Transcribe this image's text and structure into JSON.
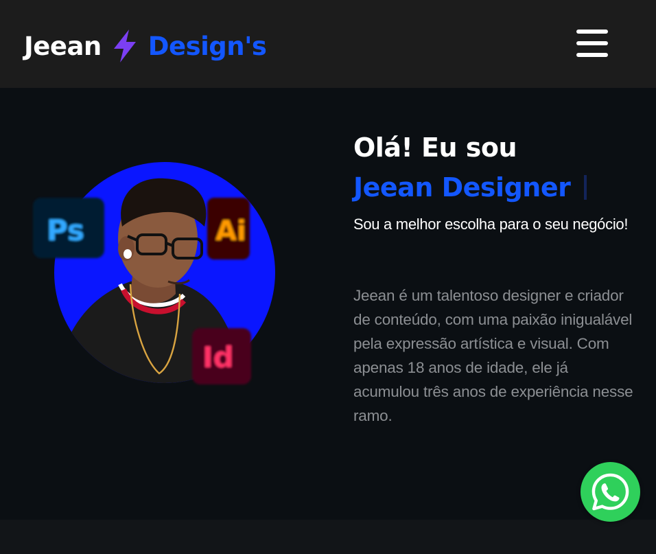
{
  "header": {
    "brand_first": "Jeean",
    "brand_second": "Design's",
    "logo_icon": "lightning-bolt-icon",
    "menu_icon": "hamburger-menu-icon"
  },
  "hero": {
    "greeting": "Olá! Eu sou",
    "name": "Jeean Designer",
    "tagline": "Sou a melhor escolha para o seu negócio!",
    "bio": "Jeean é um talentoso designer e criador de conteúdo, com uma paixão inigualável pela expressão artística e visual. Com apenas 18 anos de idade, ele já acumulou três anos de experiência nesse ramo.",
    "badges": {
      "photoshop": "Ps",
      "illustrator": "Ai",
      "indesign": "Id"
    }
  },
  "floating": {
    "whatsapp_icon": "whatsapp-icon"
  },
  "colors": {
    "accent": "#1357ff",
    "bolt": "#7b3ff2",
    "topbar": "#1c1c1c",
    "background": "#0b0f13",
    "whatsapp": "#2fd05b",
    "portrait_circle": "#0a16ff"
  }
}
